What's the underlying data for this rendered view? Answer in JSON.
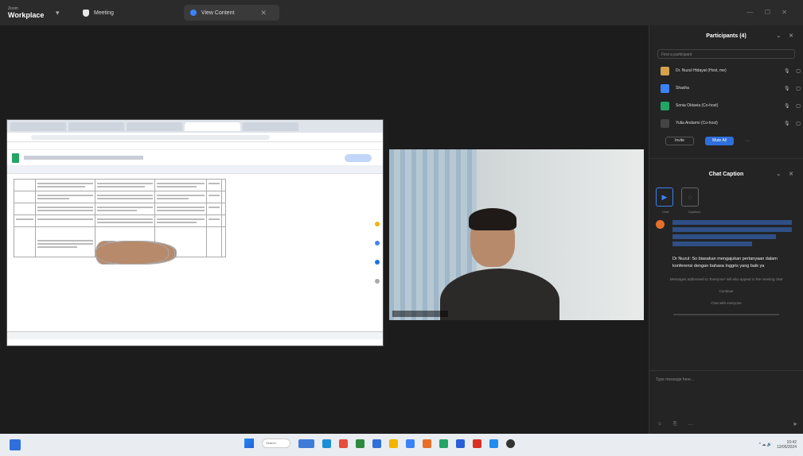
{
  "titlebar": {
    "app_small": "Zoom",
    "app_name": "Workplace",
    "meeting_tab": "Meeting",
    "share_tab": "View Content",
    "close": "✕",
    "window_controls": "— ☐ ✕"
  },
  "panel": {
    "participants_title": "Participants (4)",
    "search_placeholder": "Find a participant",
    "participants": [
      {
        "name": "Dr. Nuzul Hidayat (Host, me)",
        "color": "#d4a24a",
        "icons": "🎙 ▢"
      },
      {
        "name": "Shasha",
        "color": "#3b82f6",
        "icons": "🎙 ▢"
      },
      {
        "name": "Sonia Oktavia (Co-host)",
        "color": "#23a566",
        "icons": "🎙 ▢"
      },
      {
        "name": "Yulia Andarmi (Co-host)",
        "color": "#444",
        "icons": "🎙 ▢"
      }
    ],
    "invite_label": "Invite",
    "mute_all_label": "Mute All",
    "more": "···",
    "chat_title": "Chat Caption",
    "tool1": "Chat",
    "tool2": "Captions",
    "message": "Dr Nuzul: So biasakan mengajukan pertanyaan dalam konferensi dengan bahasa Inggris yang baik ya",
    "system_note": "Messages addressed to 'Everyone' will also appear in the meeting chat",
    "system_a": "Continue",
    "system_b": "Chat with everyone",
    "input_placeholder": "Type message here...",
    "input_icons": "☺ ⎘ …",
    "send": "➤"
  },
  "taskbar": {
    "search": "Search",
    "tray": "^ ☁ 🔊",
    "time": "10:42",
    "date": "12/05/2024"
  },
  "colors": {
    "accent": "#2f6fdb",
    "chat_highlight": "#2f4f86"
  }
}
